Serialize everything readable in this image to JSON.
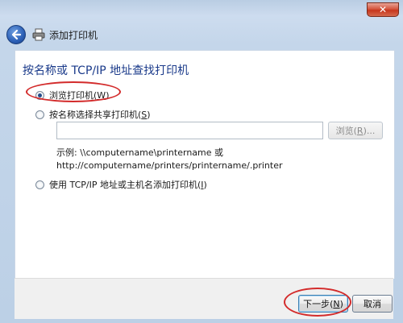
{
  "window": {
    "title": "添加打印机",
    "close_label": "✕"
  },
  "icons": {
    "back": "back-arrow-icon",
    "printer": "printer-icon",
    "close": "close-icon"
  },
  "colors": {
    "annotation": "#d32b2b",
    "heading": "#1a3a8a"
  },
  "main": {
    "heading": "按名称或 TCP/IP 地址查找打印机",
    "options": [
      {
        "label_prefix": "浏览打印机(",
        "accel": "W",
        "label_suffix": ")",
        "checked": true
      },
      {
        "label_prefix": "按名称选择共享打印机(",
        "accel": "S",
        "label_suffix": ")",
        "checked": false
      },
      {
        "label_prefix": "使用 TCP/IP 地址或主机名添加打印机(",
        "accel": "I",
        "label_suffix": ")",
        "checked": false
      }
    ],
    "path_input": {
      "value": "",
      "placeholder": ""
    },
    "browse": {
      "prefix": "浏览(",
      "accel": "R",
      "suffix": ")..."
    },
    "example_line1": "示例: \\\\computername\\printername 或",
    "example_line2": "http://computername/printers/printername/.printer"
  },
  "footer": {
    "next": {
      "prefix": "下一步(",
      "accel": "N",
      "suffix": ")"
    },
    "cancel": "取消"
  }
}
